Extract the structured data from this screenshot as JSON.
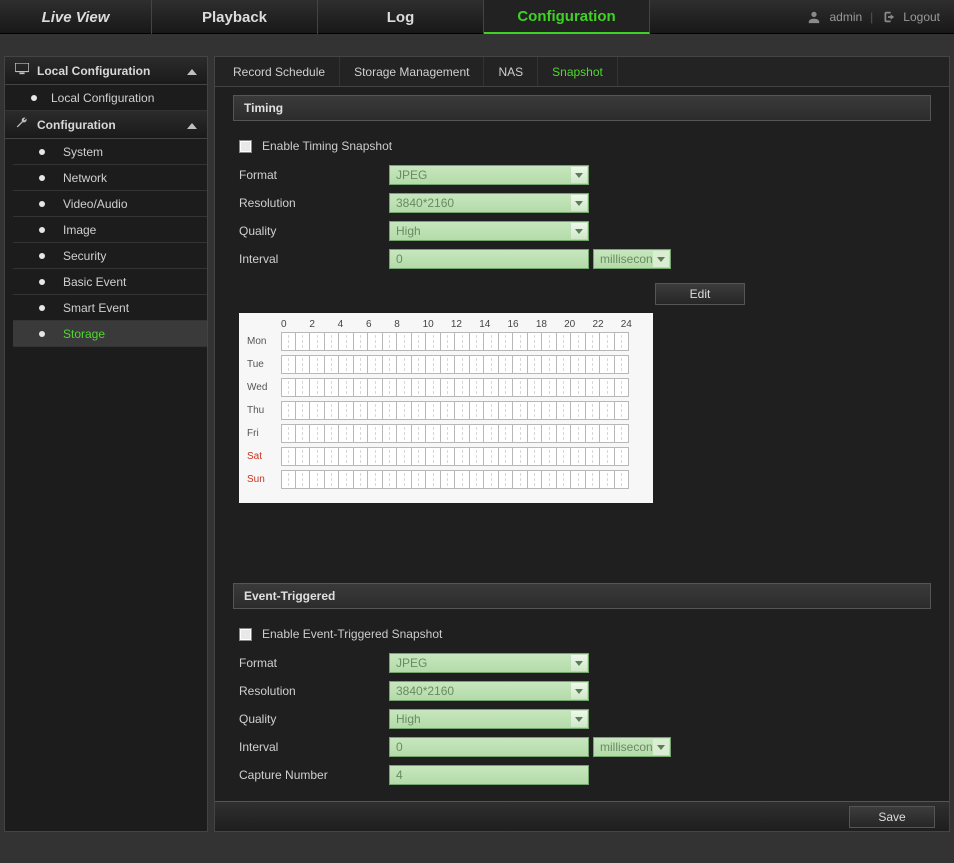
{
  "topnav": {
    "live_view": "Live View",
    "playback": "Playback",
    "log": "Log",
    "configuration": "Configuration"
  },
  "user": {
    "name": "admin",
    "logout": "Logout"
  },
  "sidebar": {
    "local_config_header": "Local Configuration",
    "local_config_item": "Local Configuration",
    "config_header": "Configuration",
    "items": {
      "system": "System",
      "network": "Network",
      "video_audio": "Video/Audio",
      "image": "Image",
      "security": "Security",
      "basic_event": "Basic Event",
      "smart_event": "Smart Event",
      "storage": "Storage"
    }
  },
  "tabs": {
    "record_schedule": "Record Schedule",
    "storage_management": "Storage Management",
    "nas": "NAS",
    "snapshot": "Snapshot"
  },
  "timing": {
    "header": "Timing",
    "enable_label": "Enable Timing Snapshot",
    "format_label": "Format",
    "format_value": "JPEG",
    "resolution_label": "Resolution",
    "resolution_value": "3840*2160",
    "quality_label": "Quality",
    "quality_value": "High",
    "interval_label": "Interval",
    "interval_value": "0",
    "interval_unit": "millisecond",
    "edit_button": "Edit"
  },
  "schedule": {
    "hours": [
      "0",
      "2",
      "4",
      "6",
      "8",
      "10",
      "12",
      "14",
      "16",
      "18",
      "20",
      "22",
      "24"
    ],
    "days": [
      "Mon",
      "Tue",
      "Wed",
      "Thu",
      "Fri",
      "Sat",
      "Sun"
    ]
  },
  "event": {
    "header": "Event-Triggered",
    "enable_label": "Enable Event-Triggered Snapshot",
    "format_label": "Format",
    "format_value": "JPEG",
    "resolution_label": "Resolution",
    "resolution_value": "3840*2160",
    "quality_label": "Quality",
    "quality_value": "High",
    "interval_label": "Interval",
    "interval_value": "0",
    "interval_unit": "millisecond",
    "capture_label": "Capture Number",
    "capture_value": "4"
  },
  "footer": {
    "save": "Save"
  }
}
